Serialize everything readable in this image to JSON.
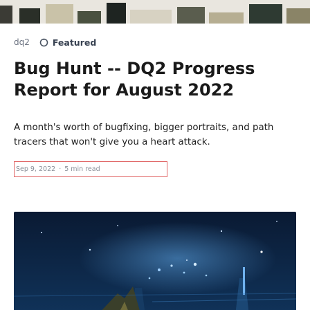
{
  "tags": {
    "repo": "dq2",
    "featured_label": "Featured"
  },
  "article": {
    "title": "Bug Hunt -- DQ2 Progress Report for August 2022",
    "summary": "A month's worth of bugfixing, bigger portraits, and path tracers that won't give you a heart attack.",
    "date": "Sep 9, 2022",
    "separator": "·",
    "read_time": "5 min read"
  },
  "icons": {
    "featured": "pushpin-icon"
  },
  "colors": {
    "meta_border": "#e06666",
    "cover_bg": "#0b1f3a"
  }
}
